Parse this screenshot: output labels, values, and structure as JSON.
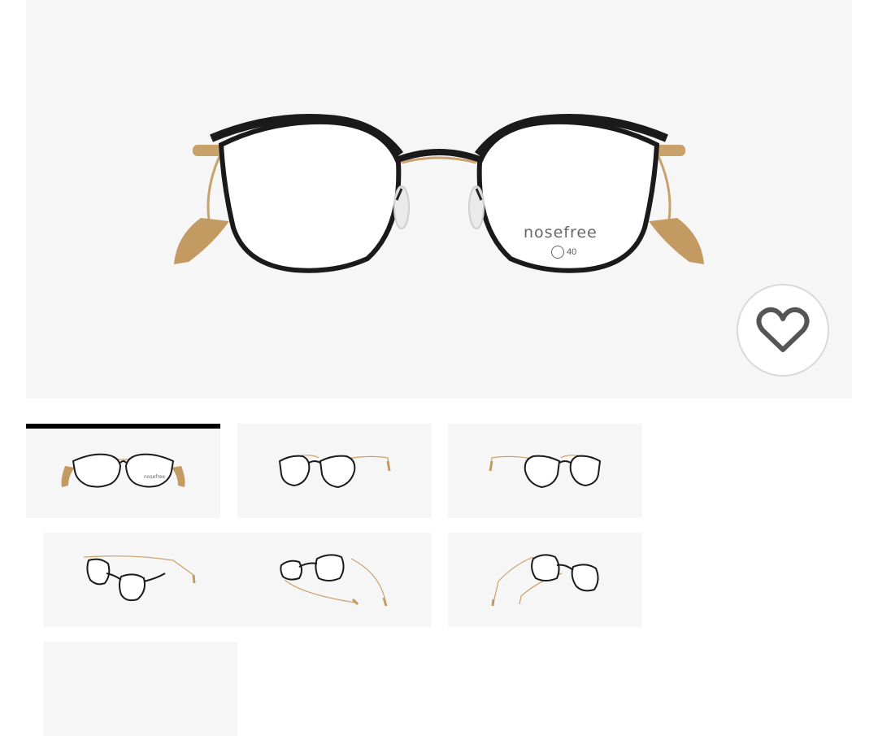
{
  "product": {
    "brand_logo": "nosefree",
    "frame_badge": "40"
  },
  "favorite": {
    "icon": "heart-icon"
  },
  "gallery": {
    "active_index": 0,
    "thumbnails": [
      {
        "view": "front"
      },
      {
        "view": "three-quarter-left"
      },
      {
        "view": "three-quarter-right"
      },
      {
        "view": "side-left"
      },
      {
        "view": "top-angle"
      },
      {
        "view": "side-right"
      },
      {
        "view": "extra"
      }
    ]
  },
  "colors": {
    "frame": "#1a1a1a",
    "temple": "#c9a16a",
    "tip": "#c39a62",
    "logo_gray": "#666666",
    "logo_accent": "#f0a020",
    "active_indicator": "#000000"
  }
}
